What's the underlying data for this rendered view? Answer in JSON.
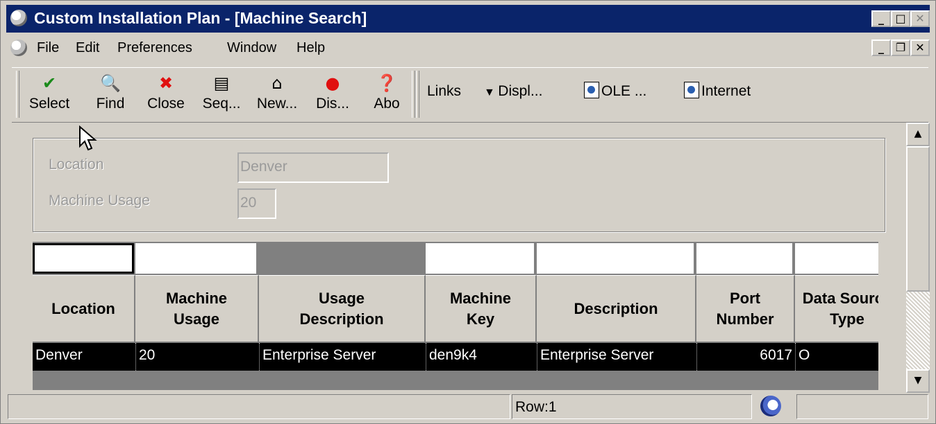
{
  "window": {
    "title": "Custom Installation Plan - [Machine Search]",
    "controls": {
      "minimize": "_",
      "maximize": "□",
      "close": "✕"
    }
  },
  "menu": {
    "items": [
      {
        "label": "File"
      },
      {
        "label": "Edit"
      },
      {
        "label": "Preferences"
      },
      {
        "label": "Window"
      },
      {
        "label": "Help"
      }
    ],
    "child_controls": {
      "minimize": "_",
      "restore": "❐",
      "close": "✕"
    }
  },
  "toolbar": {
    "buttons": [
      {
        "label": "Select",
        "icon": "check-icon",
        "color": "#1a8a1a"
      },
      {
        "label": "Find",
        "icon": "find-icon",
        "color": "#000000"
      },
      {
        "label": "Close",
        "icon": "close-x-icon",
        "color": "#e01010"
      },
      {
        "label": "Seq...",
        "icon": "sequence-icon",
        "color": "#000000"
      },
      {
        "label": "New...",
        "icon": "new-icon",
        "color": "#000000"
      },
      {
        "label": "Dis...",
        "icon": "display-icon",
        "color": "#e01010"
      },
      {
        "label": "Abo",
        "icon": "about-icon",
        "color": "#000000"
      }
    ],
    "links": [
      {
        "label": "Links"
      },
      {
        "label": "Displ..."
      },
      {
        "label": "OLE ..."
      },
      {
        "label": "Internet"
      }
    ]
  },
  "form": {
    "location_label": "Location",
    "location_value": "Denver",
    "usage_label": "Machine Usage",
    "usage_value": "20"
  },
  "grid": {
    "columns": [
      "Location",
      "Machine Usage",
      "Usage Description",
      "Machine Key",
      "Description",
      "Port Number",
      "Data Source Type"
    ],
    "rows": [
      [
        "Denver",
        "20",
        "Enterprise Server",
        "den9k4",
        "Enterprise Server",
        "6017",
        "O"
      ]
    ]
  },
  "status": {
    "row_text": "Row:1"
  }
}
